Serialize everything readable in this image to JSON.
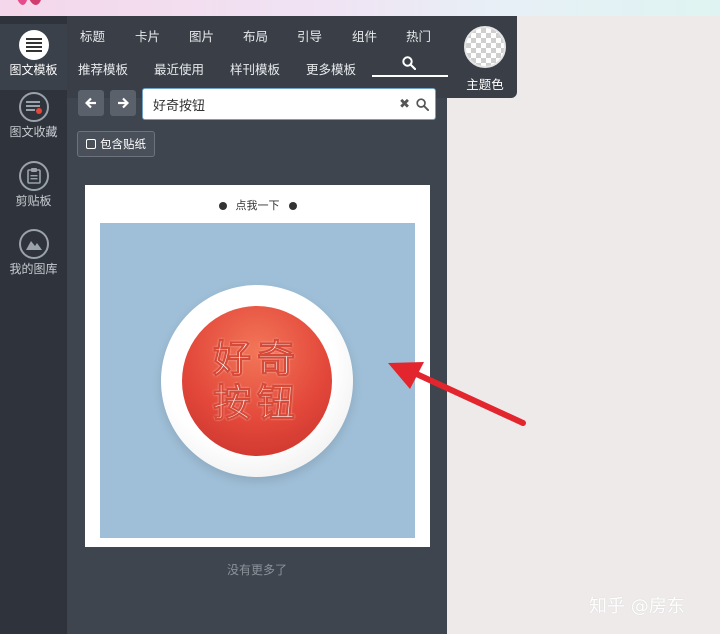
{
  "sidebar": {
    "items": [
      {
        "label": "图文模板",
        "icon": "lines-icon"
      },
      {
        "label": "图文收藏",
        "icon": "favorites-icon"
      },
      {
        "label": "剪贴板",
        "icon": "clipboard-icon"
      },
      {
        "label": "我的图库",
        "icon": "image-library-icon"
      }
    ]
  },
  "top_tabs": {
    "row1": [
      "标题",
      "卡片",
      "图片",
      "布局",
      "引导",
      "组件",
      "热门"
    ],
    "row2": [
      "推荐模板",
      "最近使用",
      "样刊模板",
      "更多模板"
    ],
    "search_tab_icon": "search-icon",
    "theme_label": "主题色"
  },
  "search": {
    "value": "好奇按钮"
  },
  "include_sticker_label": "包含贴纸",
  "result_card": {
    "title": "点我一下",
    "button_line1": "好奇",
    "button_line2": "按钮"
  },
  "no_more_label": "没有更多了",
  "watermark": "知乎 @房东",
  "colors": {
    "sidebar_bg": "#2f343c",
    "panel_bg": "#3f454e",
    "image_bg": "#9fbfd8",
    "button_red": "#e3483a",
    "arrow_red": "#e3262d"
  }
}
